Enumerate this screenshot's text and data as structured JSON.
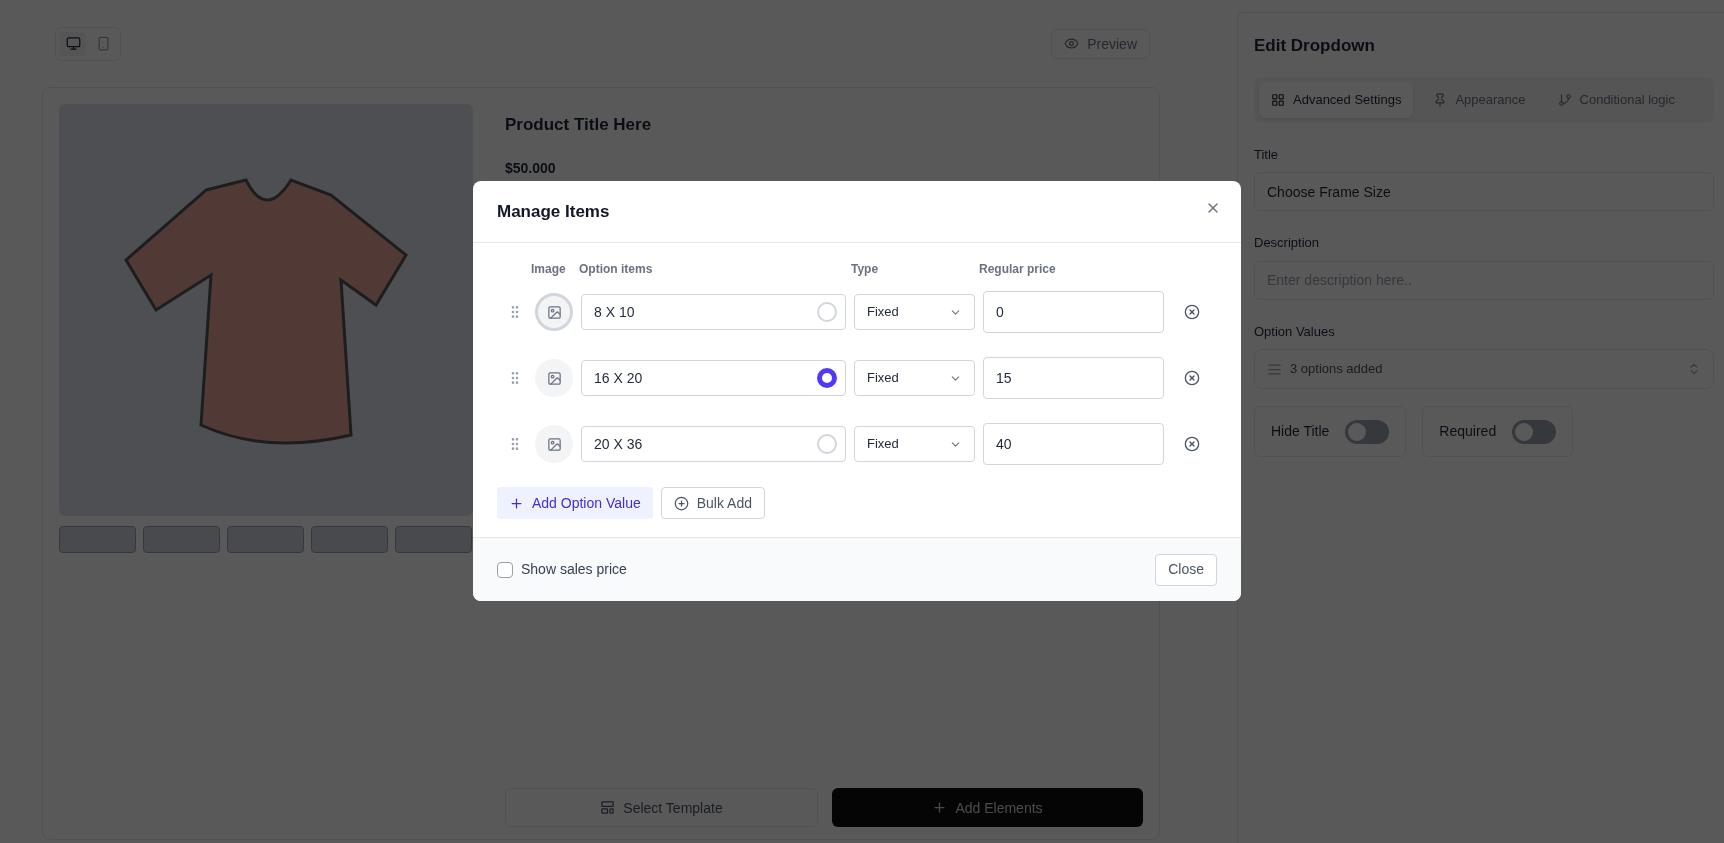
{
  "toolbar": {
    "devices": [
      {
        "kind": "desktop",
        "selected": true
      },
      {
        "kind": "mobile",
        "selected": false
      }
    ],
    "preview": "Preview"
  },
  "product": {
    "title": "Product Title Here",
    "price": "$50.000"
  },
  "actions": {
    "select_template": "Select Template",
    "add_elements": "Add Elements"
  },
  "panel": {
    "title": "Edit Dropdown",
    "tabs": [
      {
        "kind": "grid",
        "label": "Advanced Settings",
        "selected": true
      },
      {
        "kind": "pin",
        "label": "Appearance",
        "selected": false
      },
      {
        "kind": "branch",
        "label": "Conditional logic",
        "selected": false
      }
    ],
    "title_label": "Title",
    "title_value": "Choose Frame Size",
    "description_label": "Description",
    "description_placeholder": "Enter description here..",
    "options_label": "Option Values",
    "options_value": "3 options added",
    "toggles": [
      {
        "label": "Hide Title",
        "on": false
      },
      {
        "label": "Required",
        "on": false
      }
    ]
  },
  "modal": {
    "title": "Manage Items",
    "columns": [
      "Image",
      "Option items",
      "Type",
      "Regular price"
    ],
    "rows": [
      {
        "focused": true,
        "option": "8 X 10",
        "selected": false,
        "type": "Fixed",
        "price": "0"
      },
      {
        "focused": false,
        "option": "16 X 20",
        "selected": true,
        "type": "Fixed",
        "price": "15"
      },
      {
        "focused": false,
        "option": "20 X 36",
        "selected": false,
        "type": "Fixed",
        "price": "40"
      }
    ],
    "add_option": "Add Option Value",
    "bulk_add": "Bulk Add",
    "show_sales_price": {
      "label": "Show sales price",
      "checked": false
    },
    "close": "Close"
  }
}
